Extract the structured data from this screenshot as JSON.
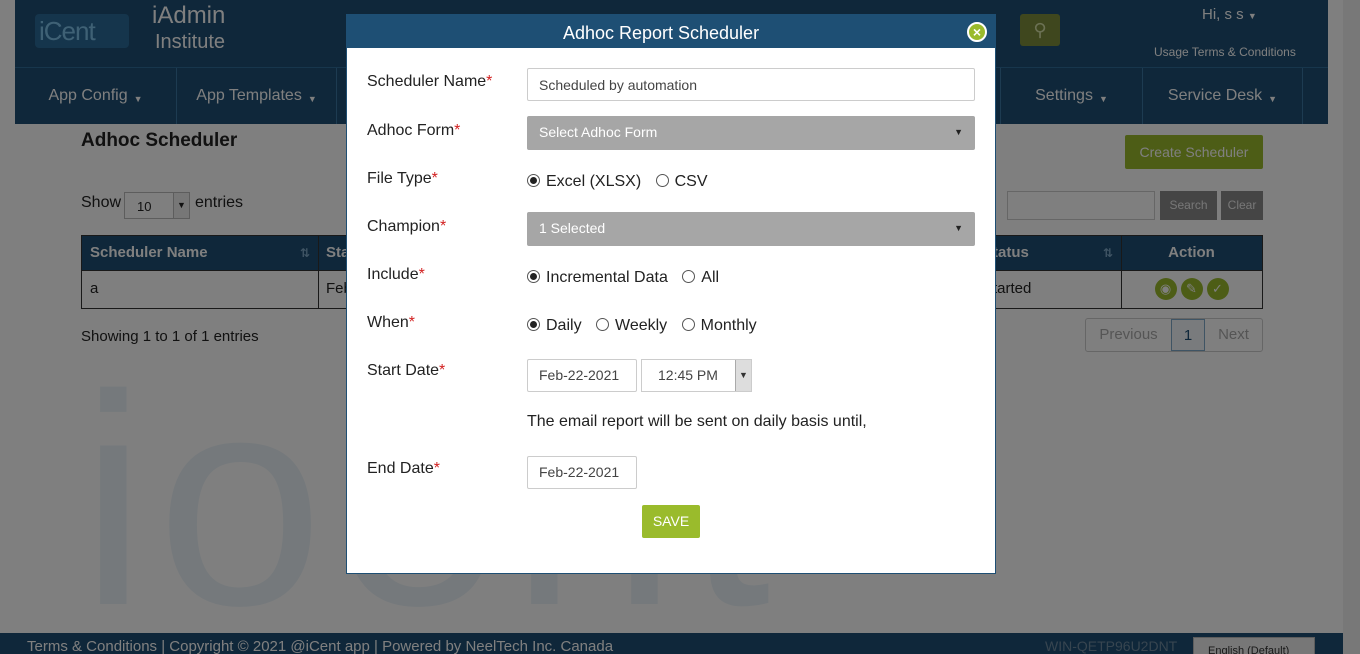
{
  "header": {
    "logo_text": "iCent",
    "app_name": "iAdmin",
    "app_subtitle": "Institute",
    "user_greeting": "Hi, s s",
    "usage_terms": "Usage Terms & Conditions"
  },
  "nav": {
    "items": [
      {
        "label": "App Config"
      },
      {
        "label": "App Templates"
      },
      {
        "label": "Settings"
      },
      {
        "label": "Service Desk"
      }
    ]
  },
  "page": {
    "title": "Adhoc Scheduler",
    "create_button": "Create Scheduler",
    "show_label": "Show",
    "entries_value": "10",
    "entries_label": "entries",
    "search_button": "Search",
    "clear_button": "Clear",
    "table": {
      "headers": [
        "Scheduler Name",
        "Sta",
        "tatus",
        "Action"
      ],
      "rows": [
        [
          "a",
          "Feb",
          "tarted"
        ]
      ]
    },
    "showing_text": "Showing 1 to 1 of 1 entries",
    "pager": {
      "previous": "Previous",
      "current": "1",
      "next": "Next"
    },
    "watermark": "ioent"
  },
  "footer": {
    "text": "Terms & Conditions | Copyright © 2021 @iCent app | Powered by NeelTech Inc. Canada",
    "host": "WIN-QETP96U2DNT",
    "language": "English (Default)"
  },
  "modal": {
    "title": "Adhoc Report Scheduler",
    "fields": {
      "scheduler_name": {
        "label": "Scheduler Name",
        "value": "Scheduled by automation"
      },
      "adhoc_form": {
        "label": "Adhoc Form",
        "value": "Select Adhoc Form"
      },
      "file_type": {
        "label": "File Type",
        "options": [
          "Excel (XLSX)",
          "CSV"
        ],
        "selected": "Excel (XLSX)"
      },
      "champion": {
        "label": "Champion",
        "value": "1 Selected"
      },
      "include": {
        "label": "Include",
        "options": [
          "Incremental Data",
          "All"
        ],
        "selected": "Incremental Data"
      },
      "when": {
        "label": "When",
        "options": [
          "Daily",
          "Weekly",
          "Monthly"
        ],
        "selected": "Daily"
      },
      "start_date": {
        "label": "Start Date",
        "date": "Feb-22-2021",
        "time": "12:45 PM"
      },
      "info_text": "The email report will be sent on daily basis until,",
      "end_date": {
        "label": "End Date",
        "date": "Feb-22-2021"
      }
    },
    "save_button": "SAVE"
  },
  "required_marker": "*",
  "colors": {
    "primary": "#1e4f74",
    "accent": "#9abb2c",
    "required": "#d21f1f"
  }
}
